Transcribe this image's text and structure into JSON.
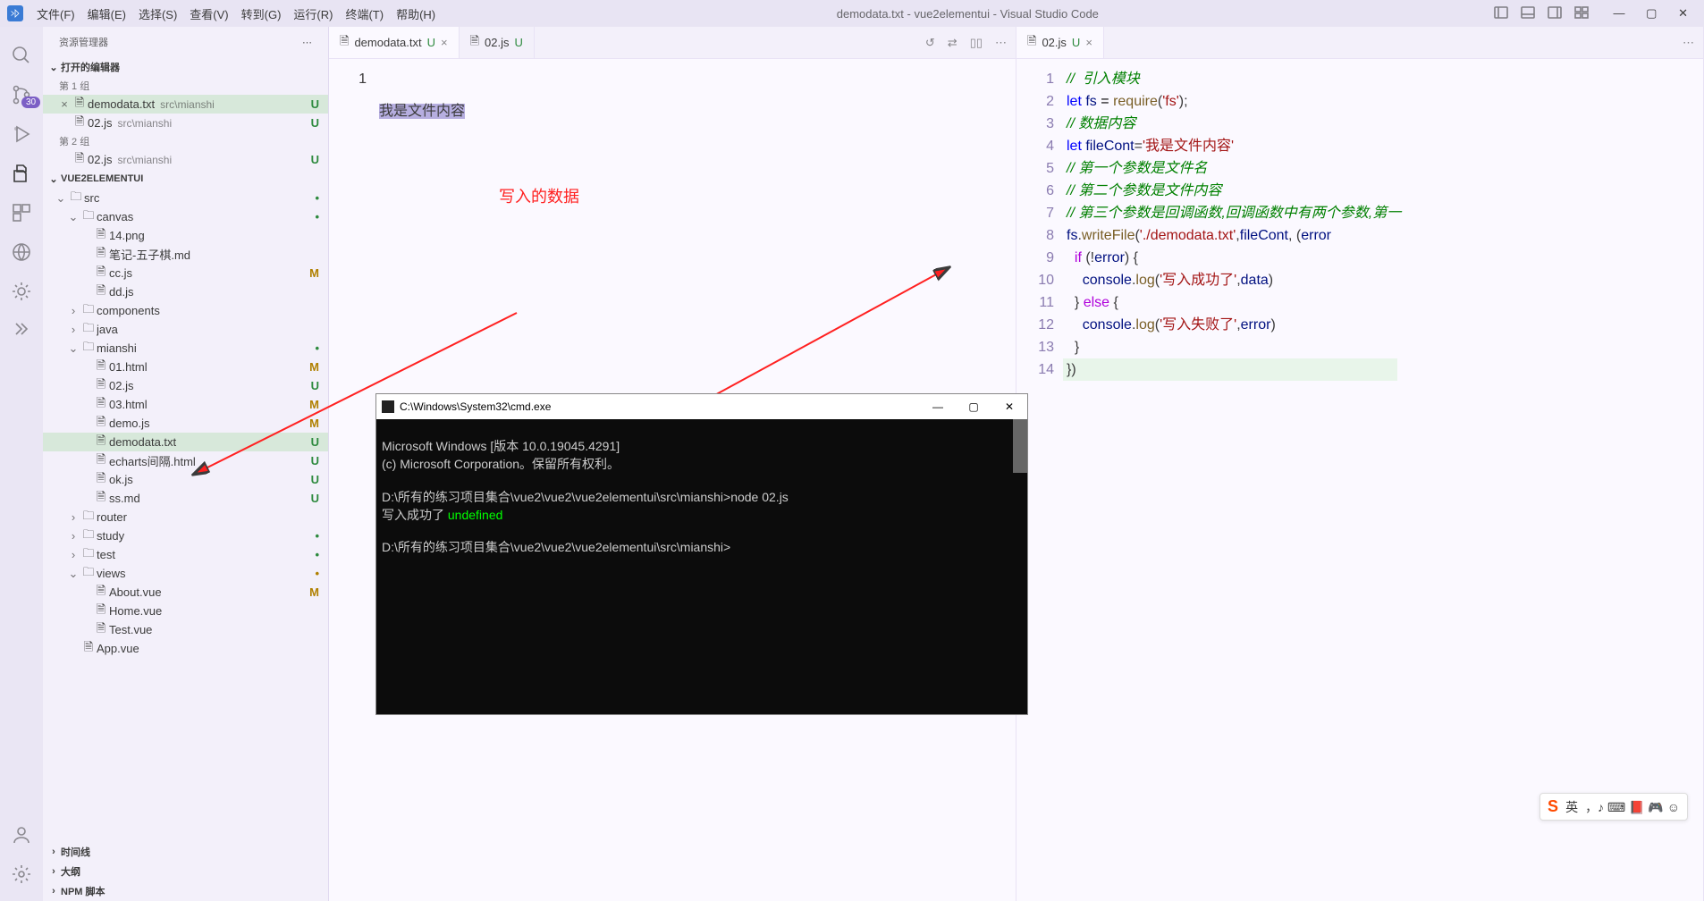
{
  "titlebar": {
    "menu": [
      "文件(F)",
      "编辑(E)",
      "选择(S)",
      "查看(V)",
      "转到(G)",
      "运行(R)",
      "终端(T)",
      "帮助(H)"
    ],
    "title": "demodata.txt - vue2elementui - Visual Studio Code"
  },
  "activitybar": {
    "badge": "30"
  },
  "sidebar": {
    "title": "资源管理器",
    "openEditorsLabel": "打开的编辑器",
    "group1": "第 1 组",
    "group2": "第 2 组",
    "openEditors": {
      "g1": [
        {
          "name": "demodata.txt",
          "desc": "src\\mianshi",
          "status": "U",
          "active": true,
          "close": true
        },
        {
          "name": "02.js",
          "desc": "src\\mianshi",
          "status": "U"
        }
      ],
      "g2": [
        {
          "name": "02.js",
          "desc": "src\\mianshi",
          "status": "U"
        }
      ]
    },
    "project": "VUE2ELEMENTUI",
    "tree": [
      {
        "indent": 0,
        "arrow": "v",
        "folder": true,
        "label": "src",
        "dot": "U"
      },
      {
        "indent": 1,
        "arrow": "v",
        "folder": true,
        "label": "canvas",
        "dot": "U"
      },
      {
        "indent": 2,
        "file": true,
        "label": "14.png"
      },
      {
        "indent": 2,
        "file": true,
        "label": "笔记-五子棋.md"
      },
      {
        "indent": 2,
        "file": true,
        "label": "cc.js",
        "status": "M"
      },
      {
        "indent": 2,
        "file": true,
        "label": "dd.js"
      },
      {
        "indent": 1,
        "arrow": ">",
        "folder": true,
        "label": "components"
      },
      {
        "indent": 1,
        "arrow": ">",
        "folder": true,
        "label": "java"
      },
      {
        "indent": 1,
        "arrow": "v",
        "folder": true,
        "label": "mianshi",
        "dot": "U"
      },
      {
        "indent": 2,
        "file": true,
        "label": "01.html",
        "status": "M"
      },
      {
        "indent": 2,
        "file": true,
        "label": "02.js",
        "status": "U"
      },
      {
        "indent": 2,
        "file": true,
        "label": "03.html",
        "status": "M"
      },
      {
        "indent": 2,
        "file": true,
        "label": "demo.js",
        "status": "M"
      },
      {
        "indent": 2,
        "file": true,
        "label": "demodata.txt",
        "status": "U",
        "selected": true
      },
      {
        "indent": 2,
        "file": true,
        "label": "echarts间隔.html",
        "status": "U"
      },
      {
        "indent": 2,
        "file": true,
        "label": "ok.js",
        "status": "U"
      },
      {
        "indent": 2,
        "file": true,
        "label": "ss.md",
        "status": "U"
      },
      {
        "indent": 1,
        "arrow": ">",
        "folder": true,
        "label": "router"
      },
      {
        "indent": 1,
        "arrow": ">",
        "folder": true,
        "label": "study",
        "dot": "U"
      },
      {
        "indent": 1,
        "arrow": ">",
        "folder": true,
        "label": "test",
        "dot": "U"
      },
      {
        "indent": 1,
        "arrow": "v",
        "folder": true,
        "label": "views",
        "dot": "M"
      },
      {
        "indent": 2,
        "file": true,
        "label": "About.vue",
        "status": "M"
      },
      {
        "indent": 2,
        "file": true,
        "label": "Home.vue"
      },
      {
        "indent": 2,
        "file": true,
        "label": "Test.vue"
      },
      {
        "indent": 1,
        "file": true,
        "label": "App.vue"
      }
    ],
    "bottomSections": [
      "时间线",
      "大纲",
      "NPM 脚本"
    ]
  },
  "annotation": {
    "label": "写入的数据"
  },
  "editorLeft": {
    "tabs": [
      {
        "label": "demodata.txt",
        "status": "U",
        "active": true,
        "close": true
      },
      {
        "label": "02.js",
        "status": "U"
      }
    ],
    "lineNumbers": [
      "1"
    ],
    "content": "我是文件内容"
  },
  "editorRight": {
    "tabs": [
      {
        "label": "02.js",
        "status": "U",
        "active": true,
        "close": true
      }
    ],
    "lineNumbers": [
      "1",
      "2",
      "3",
      "4",
      "5",
      "6",
      "7",
      "8",
      "9",
      "10",
      "11",
      "12",
      "13",
      "14"
    ],
    "code": {
      "l1": "//  引入模块",
      "l2a": "let",
      "l2b": "fs",
      "l2c": "require",
      "l2d": "'fs'",
      "l3": "// 数据内容",
      "l4a": "let",
      "l4b": "fileCont",
      "l4c": "'我是文件内容'",
      "l5": "// 第一个参数是文件名",
      "l6": "// 第二个参数是文件内容",
      "l7": "// 第三个参数是回调函数,回调函数中有两个参数,第一",
      "l8a": "fs",
      "l8b": "writeFile",
      "l8c": "'./demodata.txt'",
      "l8d": "fileCont",
      "l8e": "error",
      "l9a": "if",
      "l9b": "error",
      "l10a": "console",
      "l10b": "log",
      "l10c": "'写入成功了'",
      "l10d": "data",
      "l11a": "else",
      "l12a": "console",
      "l12b": "log",
      "l12c": "'写入失败了'",
      "l12d": "error"
    }
  },
  "cmd": {
    "title": "C:\\Windows\\System32\\cmd.exe",
    "lines": [
      "Microsoft Windows [版本 10.0.19045.4291]",
      "(c) Microsoft Corporation。保留所有权利。",
      "",
      "D:\\所有的练习项目集合\\vue2\\vue2\\vue2elementui\\src\\mianshi>node 02.js"
    ],
    "okPrefix": "写入成功了 ",
    "okValue": "undefined",
    "prompt": "D:\\所有的练习项目集合\\vue2\\vue2\\vue2elementui\\src\\mianshi>"
  },
  "ime": {
    "label": "英",
    "icons": "，♪ ⌨ 📕 🎮 ☺"
  }
}
